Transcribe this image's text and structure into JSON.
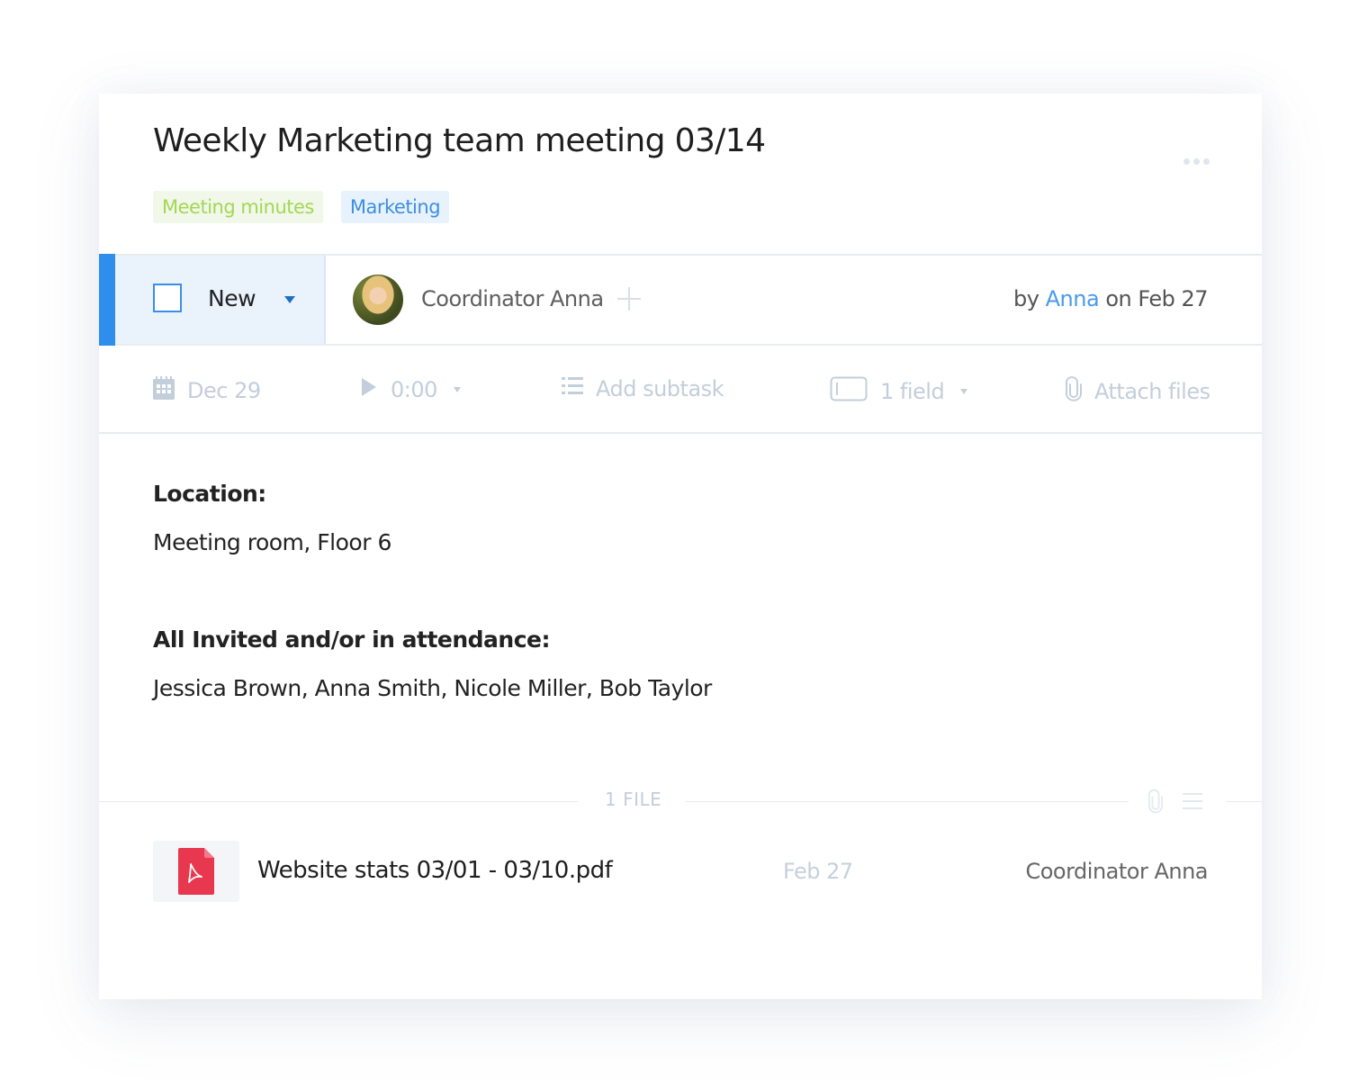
{
  "task": {
    "title": "Weekly Marketing team meeting 03/14",
    "tags": [
      {
        "label": "Meeting minutes",
        "color": "#a2d755",
        "background": "#f1f8e9"
      },
      {
        "label": "Marketing",
        "color": "#3d8fe0",
        "background": "#e8f2fc"
      }
    ],
    "more_icon": "more-horizontal-icon"
  },
  "status": {
    "label": "New",
    "accent_color": "#2f8eeb",
    "checked": false
  },
  "assignee": {
    "name": "Coordinator Anna",
    "add_icon": "plus-icon"
  },
  "byline": {
    "prefix": "by",
    "author": "Anna",
    "suffix": "on Feb 27"
  },
  "toolbar": {
    "date": {
      "label": "Dec 29",
      "icon": "calendar-icon"
    },
    "timer": {
      "label": "0:00",
      "icon": "play-icon"
    },
    "subtask": {
      "label": "Add subtask",
      "icon": "list-icon"
    },
    "field": {
      "label": "1 field",
      "icon": "field-icon"
    },
    "attach": {
      "label": "Attach files",
      "icon": "paperclip-icon"
    }
  },
  "description": {
    "sections": [
      {
        "heading": "Location:",
        "text": "Meeting room, Floor 6"
      },
      {
        "heading": "All Invited and/or in attendance:",
        "text": "Jessica Brown, Anna Smith, Nicole Miller, Bob Taylor"
      }
    ]
  },
  "files": {
    "count_label": "1 FILE",
    "items": [
      {
        "name": "Website stats 03/01 - 03/10.pdf",
        "date": "Feb 27",
        "owner": "Coordinator Anna",
        "type": "pdf"
      }
    ]
  }
}
